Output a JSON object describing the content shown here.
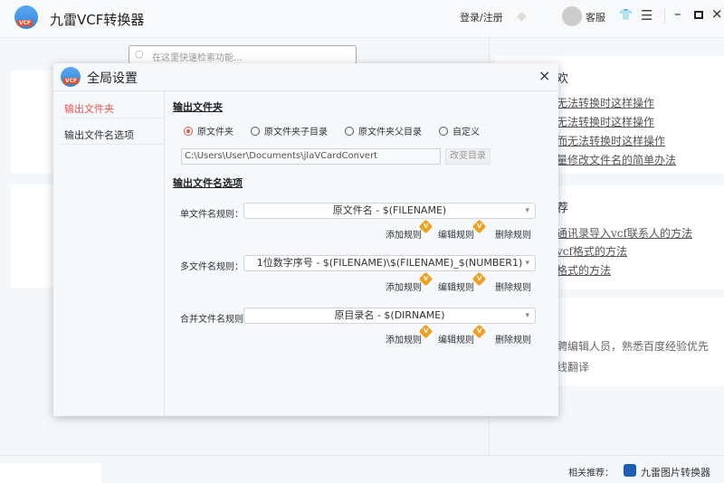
{
  "app": {
    "title": "九雷VCF转换器",
    "login": "登录/注册",
    "support": "客服",
    "search_placeholder": "在这里快速检索功能..."
  },
  "right": {
    "card1": {
      "title": "欢",
      "links": [
        "无法转换时这样操作",
        "无法转换时这样操作",
        "而无法转换时这样操作",
        "量修改文件名的简单办法"
      ]
    },
    "card2": {
      "title": "荐",
      "links": [
        "通讯录导入vcf联系人的方法",
        "vcf格式的方法",
        "格式的方法"
      ]
    },
    "card3": {
      "lines": [
        "聘编辑人员，熟悉百度经验优先",
        "线翻译"
      ]
    }
  },
  "footer": {
    "related_label": "相关推荐：",
    "related_app": "九雷图片转换器"
  },
  "dialog": {
    "title": "全局设置",
    "sidebar": [
      {
        "label": "输出文件夹",
        "active": true
      },
      {
        "label": "输出文件名选项",
        "active": false
      }
    ],
    "folder_heading": "输出文件夹",
    "radios": [
      {
        "label": "原文件夹",
        "checked": true
      },
      {
        "label": "原文件夹子目录",
        "checked": false
      },
      {
        "label": "原文件夹父目录",
        "checked": false
      },
      {
        "label": "自定义",
        "checked": false
      }
    ],
    "path": "C:\\Users\\User\\Documents\\jlaVCardConvert",
    "change_dir": "改变目录",
    "name_heading": "输出文件名选项",
    "rules": [
      {
        "label": "单文件名规则：",
        "value": "原文件名 - $(FILENAME)"
      },
      {
        "label": "多文件名规则：",
        "value": "1位数字序号 - $(FILENAME)\\$(FILENAME)_$(NUMBER1)"
      },
      {
        "label": "合并文件名规则：",
        "value": "原目录名 - $(DIRNAME)"
      }
    ],
    "actions": {
      "add": "添加规则",
      "edit": "编辑规则",
      "delete": "删除规则",
      "vip_badge": "V"
    },
    "accent": "#e9534f"
  }
}
